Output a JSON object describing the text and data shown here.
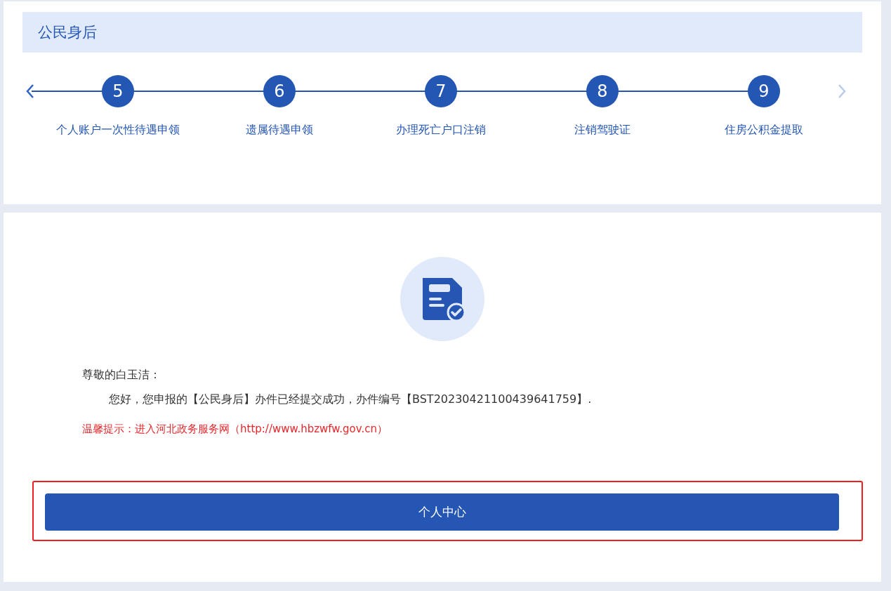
{
  "section": {
    "title": "公民身后"
  },
  "nav": {
    "prev": {
      "disabled": false
    },
    "next": {
      "disabled": true
    }
  },
  "steps": [
    {
      "number": "5",
      "label": "个人账户一次性待遇申领"
    },
    {
      "number": "6",
      "label": "遗属待遇申领"
    },
    {
      "number": "7",
      "label": "办理死亡户口注销"
    },
    {
      "number": "8",
      "label": "注销驾驶证"
    },
    {
      "number": "9",
      "label": "住房公积金提取"
    }
  ],
  "result": {
    "greeting": "尊敬的白玉洁：",
    "message": "您好，您申报的【公民身后】办件已经提交成功，办件编号【BST20230421100439641759】.",
    "tip": "温馨提示：进入河北政务服务网（http://www.hbzwfw.gov.cn）"
  },
  "action_button": {
    "label": "个人中心",
    "highlighted": true
  }
}
